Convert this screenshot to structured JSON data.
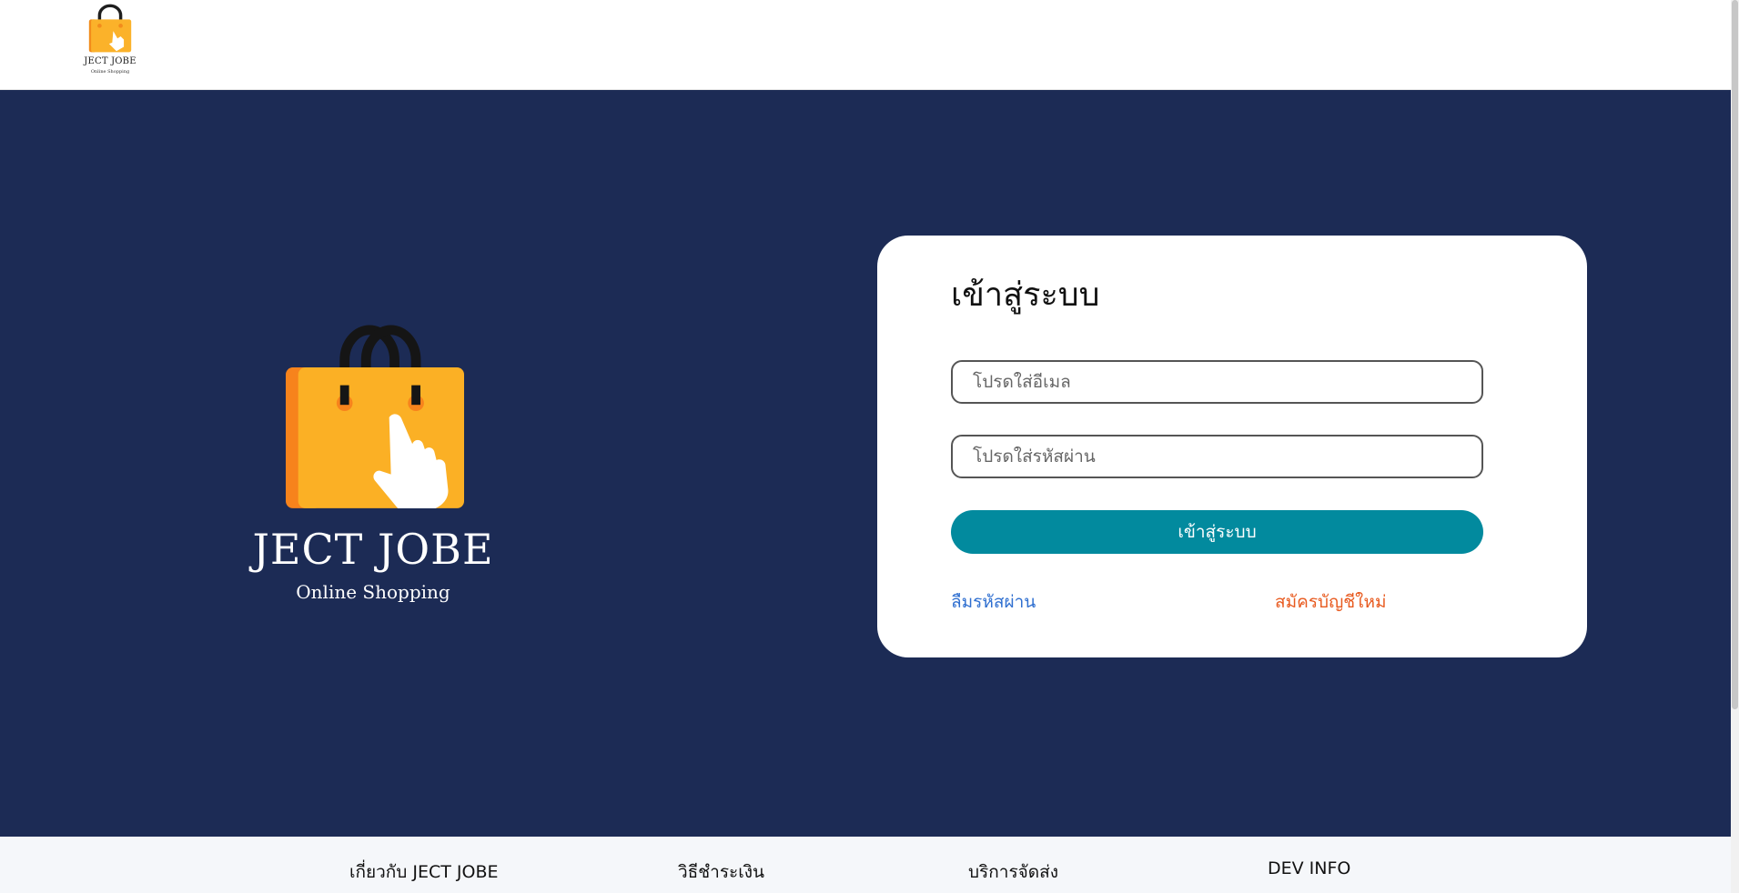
{
  "header": {
    "logo": {
      "brand": "JECT JOBE",
      "tagline": "Online Shopping",
      "icon": "shopping-bag-hand-icon"
    }
  },
  "hero": {
    "logo": {
      "brand": "JECT JOBE",
      "tagline": "Online Shopping",
      "icon": "shopping-bag-hand-icon"
    }
  },
  "login": {
    "title": "เข้าสู่ระบบ",
    "email": {
      "value": "",
      "placeholder": "โปรดใส่อีเมล"
    },
    "password": {
      "value": "",
      "placeholder": "โปรดใส่รหัสผ่าน"
    },
    "submit_label": "เข้าสู่ระบบ",
    "forgot_label": "ลืมรหัสผ่าน",
    "register_label": "สมัครบัญชีใหม่"
  },
  "footer": {
    "items": [
      {
        "label": "เกี่ยวกับ JECT JOBE"
      },
      {
        "label": "วิธีชำระเงิน"
      },
      {
        "label": "บริการจัดส่ง"
      },
      {
        "label": "DEV INFO"
      }
    ]
  },
  "colors": {
    "background": "#1c2b55",
    "accent": "#028a9e",
    "link_blue": "#2f6fd0",
    "link_orange": "#e85a1f",
    "bag_orange": "#fbb22a"
  }
}
